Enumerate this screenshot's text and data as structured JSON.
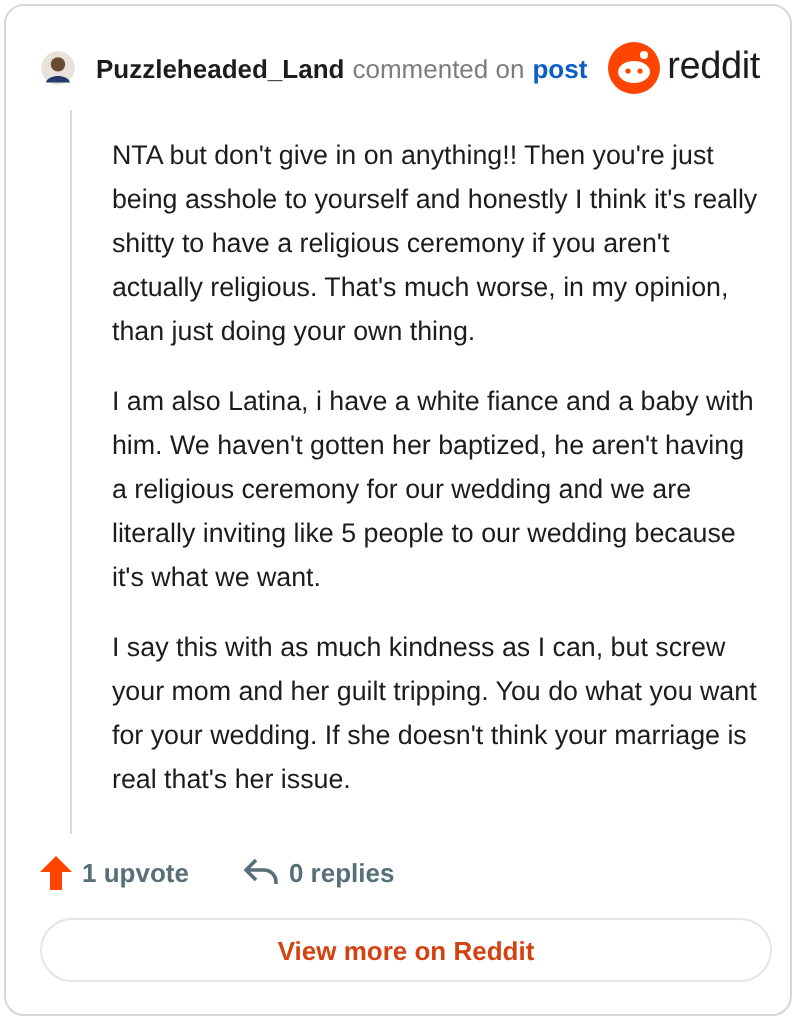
{
  "comment": {
    "author": "Puzzleheaded_Land",
    "action": "commented on",
    "target": "post",
    "brand": "reddit",
    "paragraphs": [
      "NTA but don't give in on anything!! Then you're just being asshole to yourself and honestly I think it's really shitty to have a religious ceremony if you aren't actually religious. That's much worse, in my opinion, than just doing your own thing.",
      "I am also Latina, i have a white fiance and a baby with him. We haven't gotten her baptized, he aren't having a religious ceremony for our wedding and we are literally inviting like 5 people to our wedding because it's what we want.",
      "I say this with as much kindness as I can, but screw your mom and her guilt tripping. You do what you want for your wedding. If she doesn't think your marriage is real that's her issue."
    ],
    "upvotes": "1 upvote",
    "replies": "0 replies",
    "button": "View more on Reddit"
  }
}
